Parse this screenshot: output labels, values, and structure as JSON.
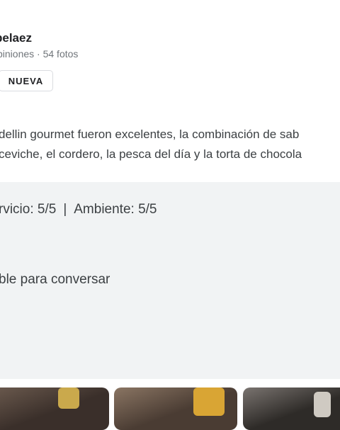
{
  "reviewer": {
    "name": "pelaez",
    "meta": "piniones · 54 fotos",
    "badge": "NUEVA"
  },
  "review": {
    "line1": "dellin gourmet fueron excelentes, la combinación de sab",
    "line2": "ceviche, el cordero, la pesca del día y la torta de chocola"
  },
  "details": {
    "service": "rvicio: 5/5",
    "separator": "|",
    "ambience": "Ambiente: 5/5",
    "noise": "ble para conversar"
  },
  "photos": [
    {
      "name": "photo-1",
      "colors": [
        "#3a2f2a",
        "#6b5a4e",
        "#c9a64a"
      ]
    },
    {
      "name": "photo-2",
      "colors": [
        "#4a3c33",
        "#8a7563",
        "#d9a534"
      ]
    },
    {
      "name": "photo-3",
      "colors": [
        "#2e2b28",
        "#7a7470",
        "#cfcac2"
      ]
    }
  ]
}
